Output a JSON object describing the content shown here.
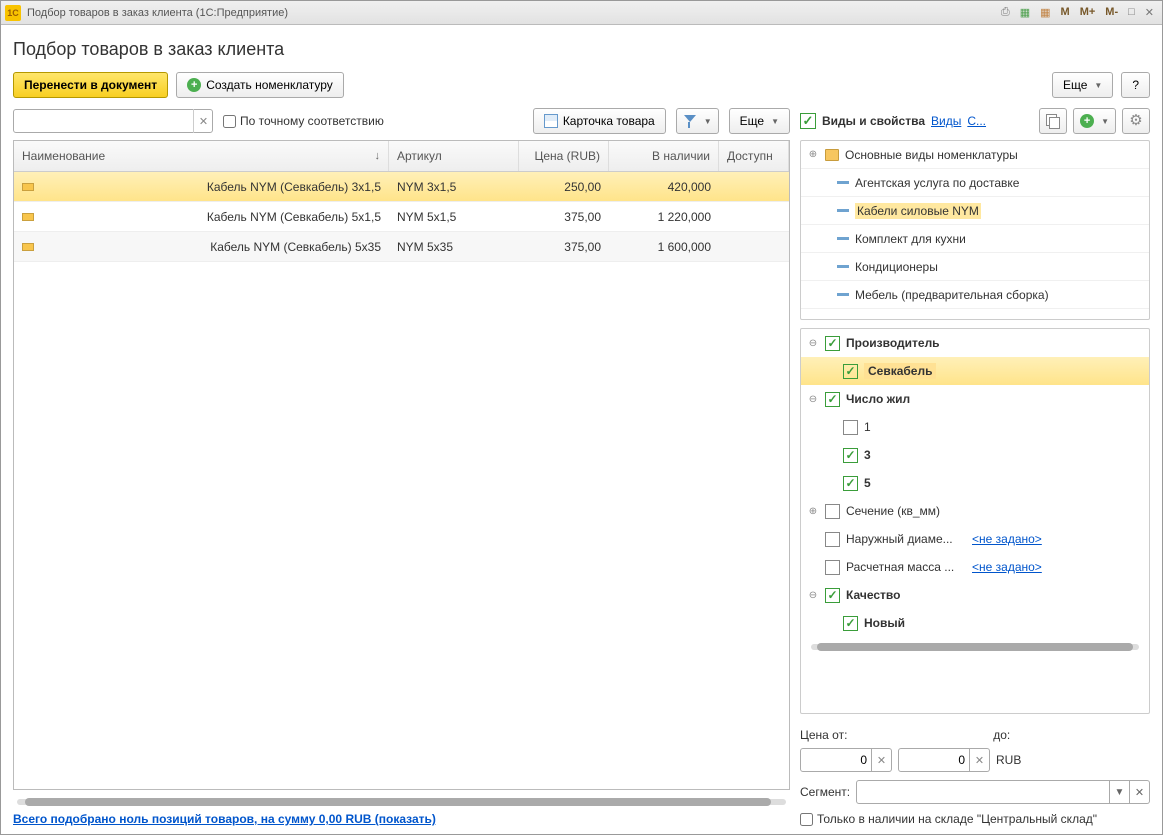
{
  "titlebar": {
    "app_icon": "1C",
    "title": "Подбор товаров в заказ клиента  (1С:Предприятие)",
    "sysbtns": {
      "m1": "M",
      "m2": "M+",
      "m3": "M-"
    }
  },
  "header": {
    "h1": "Подбор товаров в заказ клиента"
  },
  "toolbar": {
    "transfer": "Перенести в документ",
    "create": "Создать номенклатуру",
    "more": "Еще",
    "help": "?"
  },
  "search": {
    "value": "",
    "exact_label": "По точному соответствию",
    "card": "Карточка товара",
    "more": "Еще"
  },
  "table": {
    "cols": {
      "name": "Наименование",
      "art": "Артикул",
      "price": "Цена (RUB)",
      "stock": "В наличии",
      "avail": "Доступн"
    },
    "rows": [
      {
        "name": "Кабель NYM (Севкабель) 3x1,5",
        "art": "NYM 3x1,5",
        "price": "250,00",
        "stock": "420,000",
        "avail": ""
      },
      {
        "name": "Кабель NYM (Севкабель) 5x1,5",
        "art": "NYM 5x1,5",
        "price": "375,00",
        "stock": "1 220,000",
        "avail": ""
      },
      {
        "name": "Кабель NYM (Севкабель) 5x35",
        "art": "NYM 5x35",
        "price": "375,00",
        "stock": "1 600,000",
        "avail": ""
      }
    ]
  },
  "footer": {
    "summary": "Всего подобрано ноль позиций товаров, на сумму 0,00 RUB (показать)"
  },
  "rightpanel": {
    "hdr": {
      "title": "Виды и свойства",
      "link1": "Виды",
      "link2": "С..."
    },
    "types": [
      {
        "icon": "folder",
        "label": "Основные виды номенклатуры",
        "exp": "+"
      },
      {
        "icon": "dash",
        "label": "Агентская услуга по доставке"
      },
      {
        "icon": "dash",
        "label": "Кабели силовые NYM",
        "hl": true
      },
      {
        "icon": "dash",
        "label": "Комплект для кухни"
      },
      {
        "icon": "dash",
        "label": "Кондиционеры"
      },
      {
        "icon": "dash",
        "label": "Мебель (предварительная сборка)"
      }
    ],
    "filters": {
      "groups": [
        {
          "label": "Производитель",
          "checked": true,
          "exp": "-",
          "children": [
            {
              "label": "Севкабель",
              "checked": true,
              "hl": true
            }
          ]
        },
        {
          "label": "Число жил",
          "checked": true,
          "exp": "-",
          "children": [
            {
              "label": "1",
              "checked": false
            },
            {
              "label": "3",
              "checked": true
            },
            {
              "label": "5",
              "checked": true
            }
          ]
        },
        {
          "label": "Сечение (кв_мм)",
          "checked": false,
          "exp": "+"
        },
        {
          "label": "Наружный диаме...",
          "checked": false,
          "link": "<не задано>"
        },
        {
          "label": "Расчетная масса ...",
          "checked": false,
          "link": "<не задано>"
        },
        {
          "label": "Качество",
          "checked": true,
          "exp": "-",
          "children": [
            {
              "label": "Новый",
              "checked": true
            }
          ]
        }
      ]
    },
    "price": {
      "from_lbl": "Цена от:",
      "to_lbl": "до:",
      "from": "0",
      "to": "0",
      "cur": "RUB"
    },
    "segment": {
      "lbl": "Сегмент:",
      "value": ""
    },
    "stockonly": "Только в наличии на складе \"Центральный склад\""
  }
}
